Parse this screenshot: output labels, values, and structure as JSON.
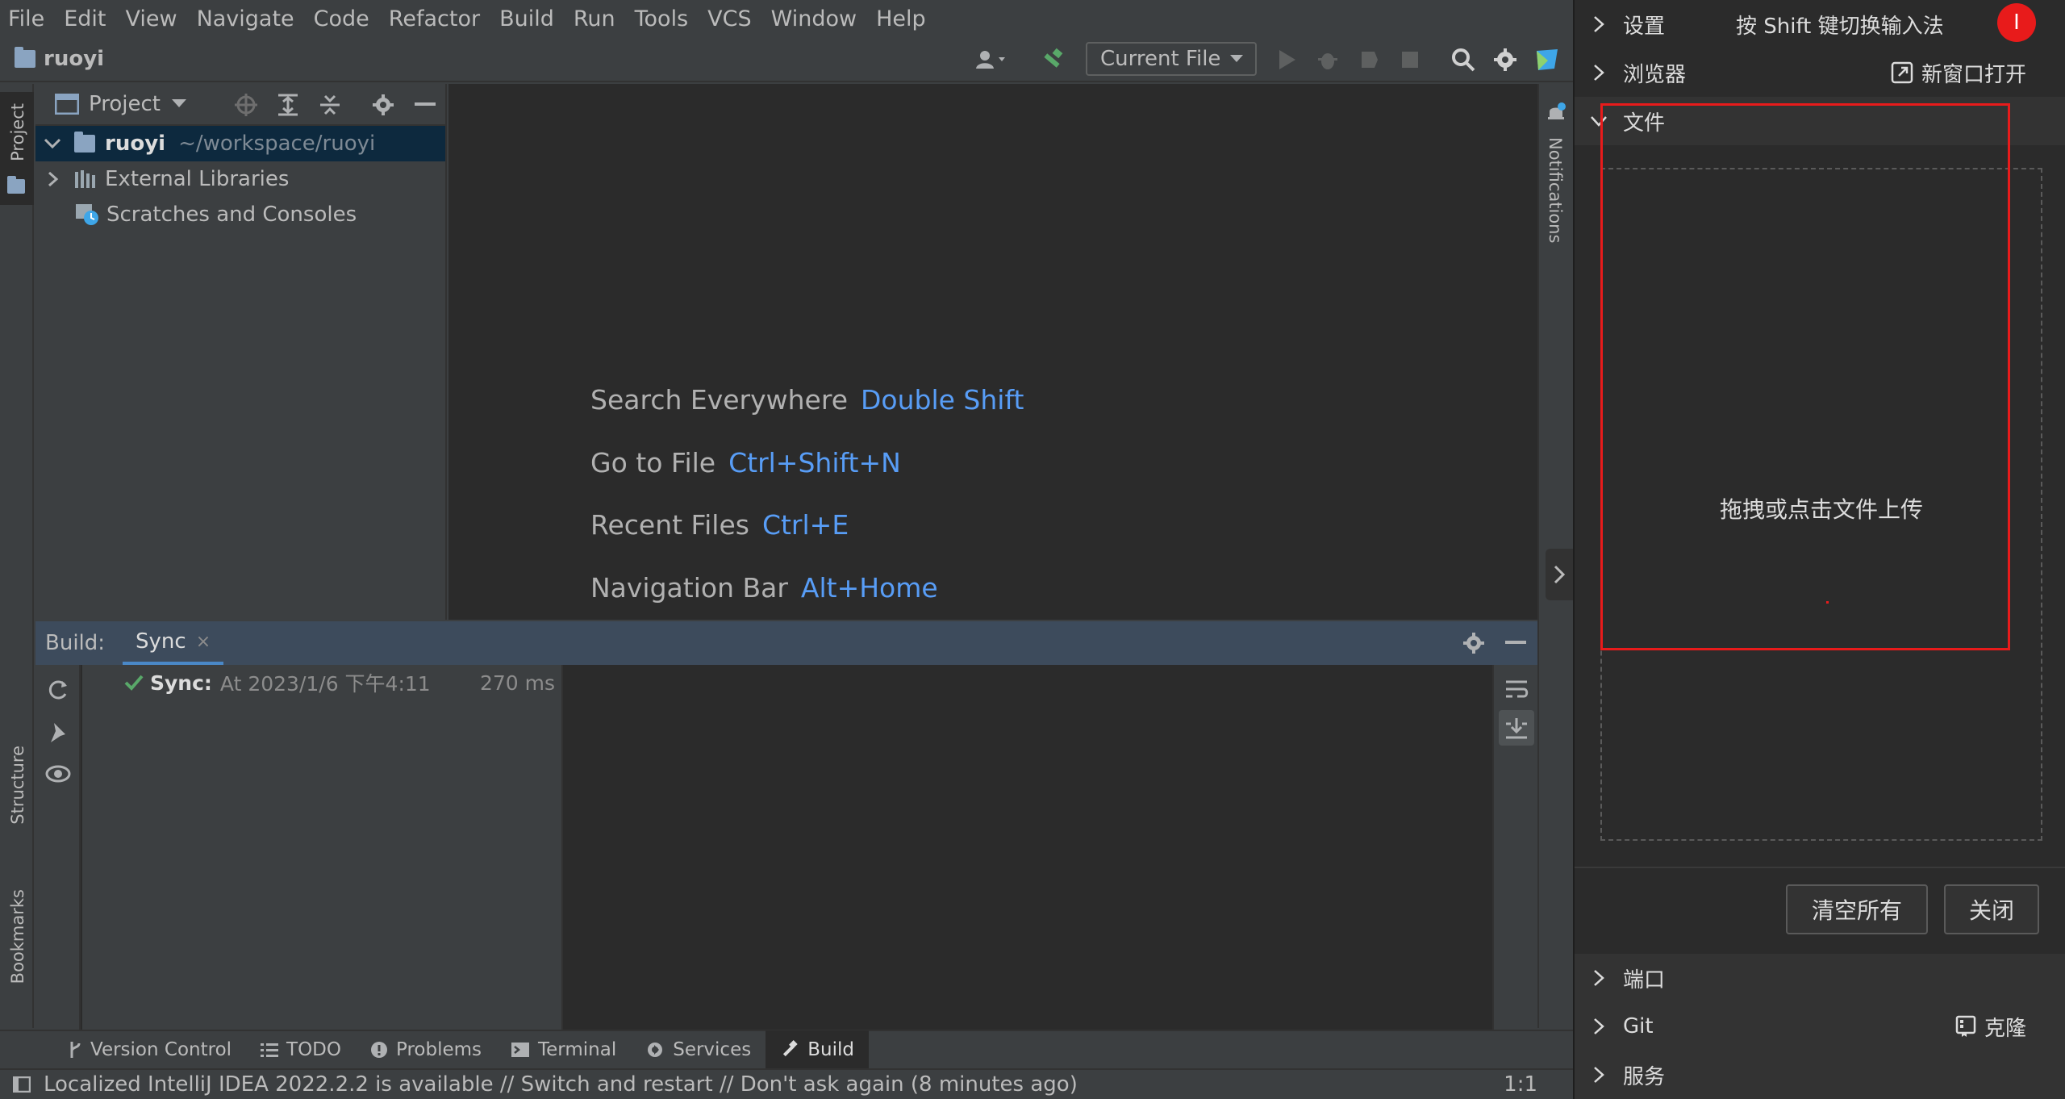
{
  "menu": [
    "File",
    "Edit",
    "View",
    "Navigate",
    "Code",
    "Refactor",
    "Build",
    "Run",
    "Tools",
    "VCS",
    "Window",
    "Help"
  ],
  "navbar": {
    "project": "ruoyi",
    "run_config": "Current File"
  },
  "left_stripe": {
    "project": "Project",
    "structure": "Structure",
    "bookmarks": "Bookmarks"
  },
  "right_stripe": {
    "notifications": "Notifications"
  },
  "project_panel": {
    "title": "Project",
    "tree": [
      {
        "name": "ruoyi",
        "path": "~/workspace/ruoyi",
        "selected": true
      },
      {
        "name": "External Libraries"
      },
      {
        "name": "Scratches and Consoles"
      }
    ]
  },
  "editor_hints": [
    {
      "text": "Search Everywhere",
      "key": "Double Shift"
    },
    {
      "text": "Go to File",
      "key": "Ctrl+Shift+N"
    },
    {
      "text": "Recent Files",
      "key": "Ctrl+E"
    },
    {
      "text": "Navigation Bar",
      "key": "Alt+Home"
    }
  ],
  "build": {
    "label": "Build:",
    "tab": "Sync",
    "close": "×",
    "entry": {
      "title": "Sync:",
      "detail": "At 2023/1/6 下午4:11",
      "duration": "270 ms"
    }
  },
  "tool_tabs": [
    "Version Control",
    "TODO",
    "Problems",
    "Terminal",
    "Services",
    "Build"
  ],
  "status": {
    "message": "Localized IntelliJ IDEA 2022.2.2 is available // Switch and restart // Don't ask again (8 minutes ago)",
    "position": "1:1"
  },
  "side_panel": {
    "settings": "设置",
    "ime_hint": "按 Shift 键切换输入法",
    "badge": "I",
    "browser": "浏览器",
    "new_window": "新窗口打开",
    "files": "文件",
    "upload_hint": "拖拽或点击文件上传",
    "clear_all": "清空所有",
    "close": "关闭",
    "port": "端口",
    "git": "Git",
    "clone": "克隆",
    "services": "服务"
  }
}
